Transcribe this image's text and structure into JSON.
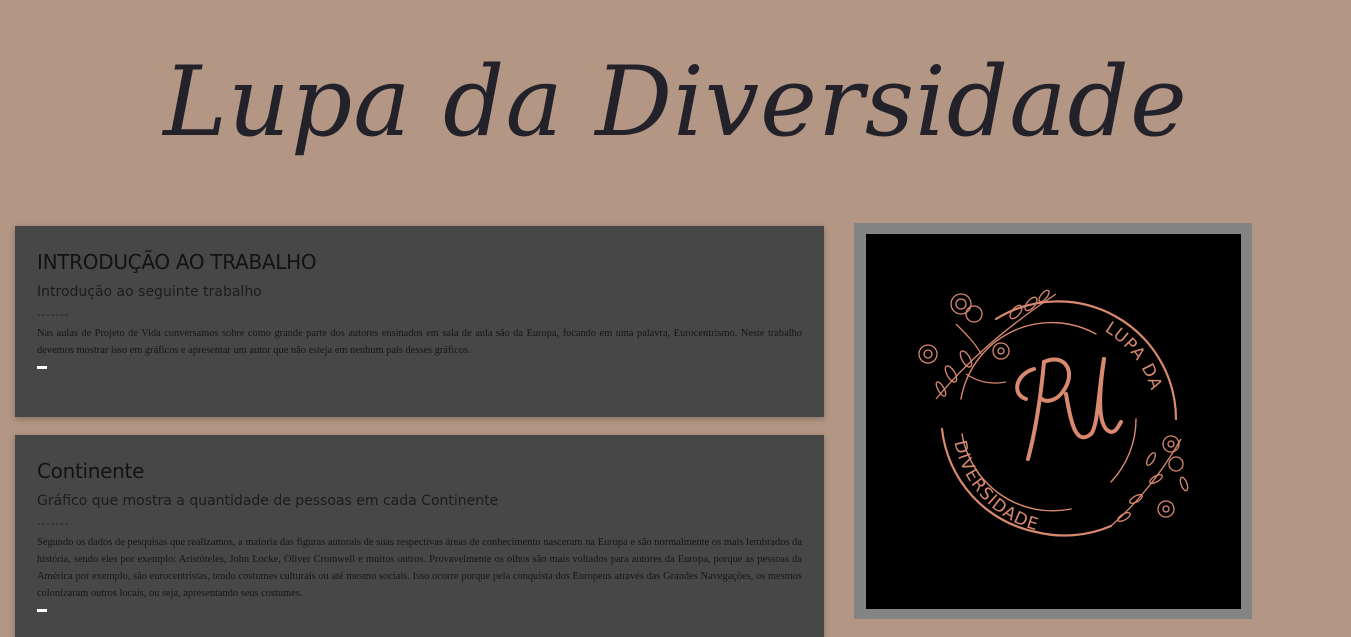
{
  "header": {
    "title": "Lupa da Diversidade"
  },
  "sections": [
    {
      "heading": "INTRODUÇÃO AO TRABALHO",
      "subheading": "Introdução ao seguinte trabalho",
      "divider": "-------",
      "body": "Nas aulas de Projeto de Vida conversamos sobre como grande parte dos autores ensinados em sala de aula são da Europa, focando em uma palavra, Eurocentrismo. Neste trabalho devemos mostrar isso em gráficos e apresentar um autor que não esteja em nenhum país desses gráficos."
    },
    {
      "heading": "Continente",
      "subheading": "Gráfico que mostra a quantidade de pessoas em cada Continente",
      "divider": "-------",
      "body": "Segundo os dados de pesquisas que realizamos, a maioria das figuras autorais de suas respectivas áreas de conhecimento nasceram na Europa e são normalmente os mais lembrados da história, sendo eles por exemplo: Aristóteles, John Locke, Oliver Cromwell e muitos outros. Provavelmente os olhos são mais voltados para autores da Europa, porque as pessoas da América por exemplo, são eurocentristas, tendo costumes culturais ou até mesmo sociais. Isso ocorre porque pela conquista dos Europeus através das Grandes Navegações, os mesmos colonizaram outros locais, ou seja, apresentando seus costumes."
    }
  ],
  "logo": {
    "monogram": "PU",
    "arc_top": "LUPA DA",
    "arc_bottom": "DIVERSIDADE",
    "icon": "floral-wreath-logo",
    "color": "#d8896f"
  },
  "colors": {
    "background": "#b39683",
    "card": "#474747",
    "logo_frame": "#848484",
    "title": "#23222b"
  }
}
